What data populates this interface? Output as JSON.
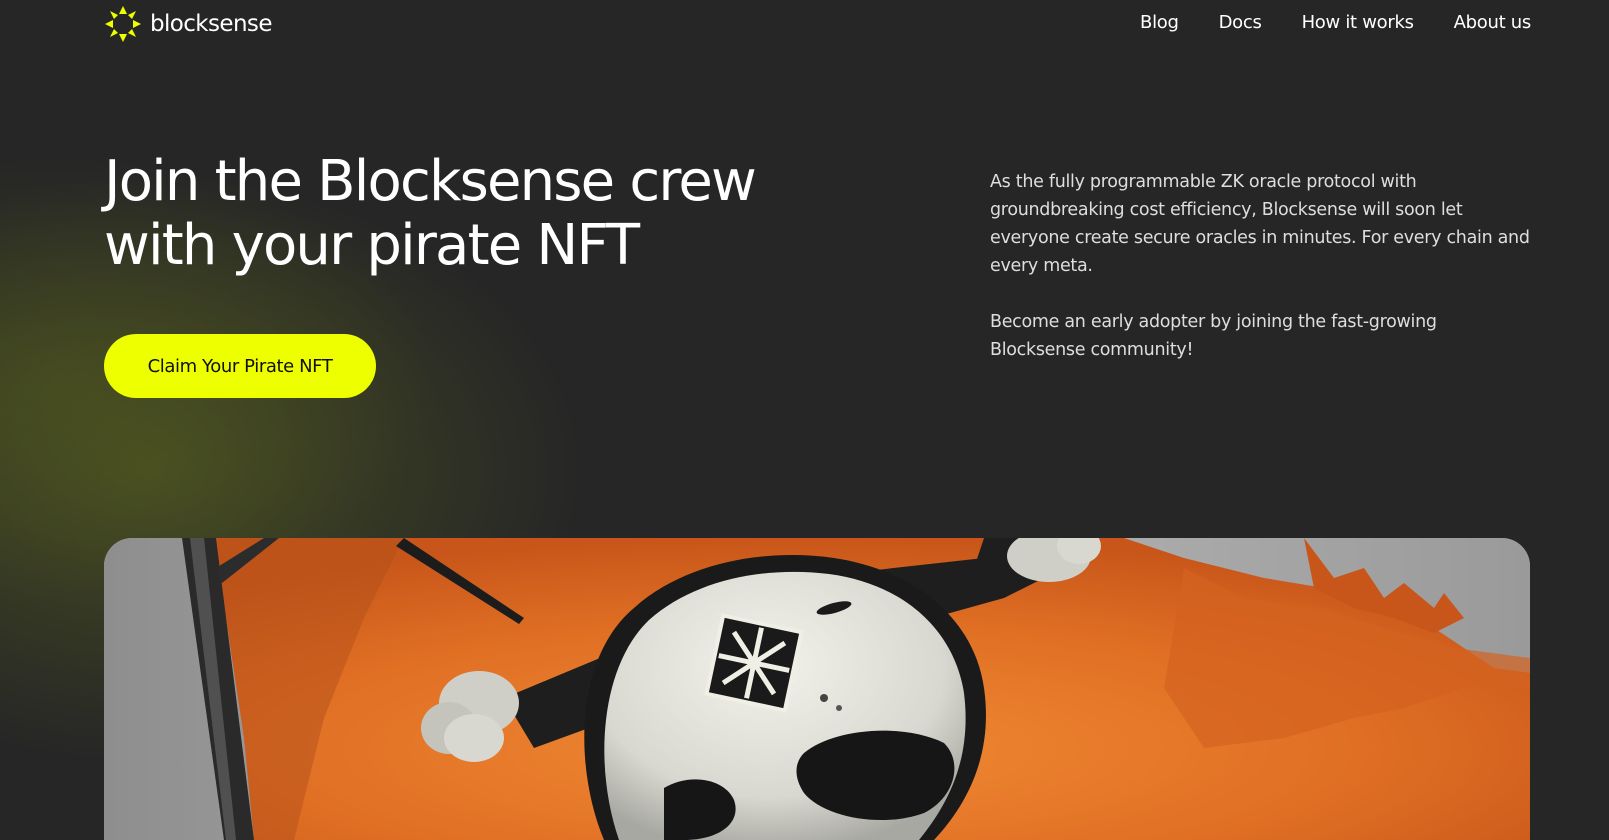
{
  "header": {
    "logo_text": "blocksense",
    "logo_icon": "blocksense-logo-icon",
    "nav": [
      {
        "label": "Blog"
      },
      {
        "label": "Docs"
      },
      {
        "label": "How it works"
      },
      {
        "label": "About us"
      }
    ]
  },
  "hero": {
    "title": "Join the Blocksense crew with your pirate NFT",
    "cta_label": "Claim Your Pirate NFT",
    "description": [
      "As the fully programmable ZK oracle protocol with groundbreaking cost efficiency, Blocksense will soon let everyone create secure oracles in minutes. For every chain and every meta.",
      "Become an early adopter by joining the fast-growing Blocksense community!"
    ]
  },
  "nft_image": {
    "icon": "pirate-skull-flag-image"
  },
  "colors": {
    "accent": "#eeff00",
    "background": "#262626",
    "flag_orange": "#e8782c"
  }
}
